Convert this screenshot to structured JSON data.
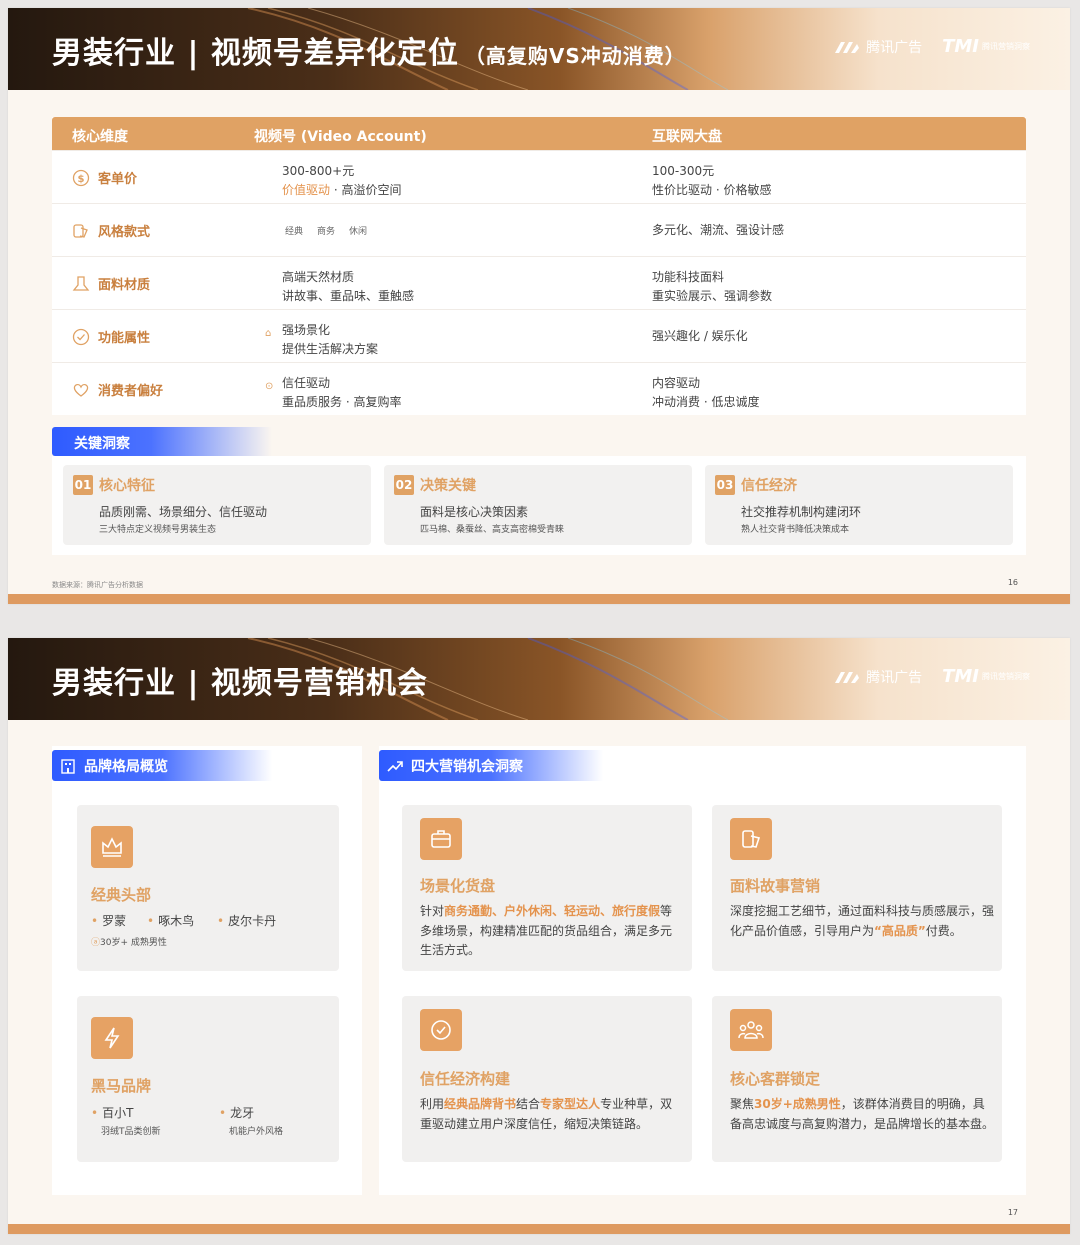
{
  "slide1": {
    "title": "男装行业 | 视频号差异化定位",
    "title_sub": "（高复购VS冲动消费）",
    "logo_tencent": "腾讯广告",
    "logo_tmi_mark": "TMI",
    "logo_tmi_text": "腾讯营销洞察",
    "table": {
      "headers": [
        "核心维度",
        "视频号 (Video Account)",
        "互联网大盘"
      ],
      "rows": [
        {
          "dim": "客单价",
          "icon": "dollar-icon",
          "va_line1": "300-800+元",
          "va_line2_hl": "价值驱动",
          "va_sep": "·",
          "va_line2_rest": "高溢价空间",
          "net_line1": "100-300元",
          "net_line2": "性价比驱动 · 价格敏感"
        },
        {
          "dim": "风格款式",
          "icon": "style-icon",
          "va_tags": [
            "经典",
            "商务",
            "休闲"
          ],
          "net_line1": "多元化、潮流、强设计感"
        },
        {
          "dim": "面料材质",
          "icon": "fabric-icon",
          "va_line1": "高端天然材质",
          "va_line2": "讲故事、重品味、重触感",
          "net_line1": "功能科技面料",
          "net_line2": "重实验展示、强调参数"
        },
        {
          "dim": "功能属性",
          "icon": "check-circle-icon",
          "va_line1": "强场景化",
          "va_line2": "提供生活解决方案",
          "net_line1": "强兴趣化 / 娱乐化"
        },
        {
          "dim": "消费者偏好",
          "icon": "heart-icon",
          "va_line1": "信任驱动",
          "va_line2": "重品质服务 · 高复购率",
          "net_line1": "内容驱动",
          "net_line2": "冲动消费 · 低忠诚度"
        }
      ]
    },
    "insight_title": "关键洞察",
    "insights": [
      {
        "num": "01",
        "title": "核心特征",
        "line1": "品质刚需、场景细分、信任驱动",
        "line2": "三大特点定义视频号男装生态"
      },
      {
        "num": "02",
        "title": "决策关键",
        "line1": "面料是核心决策因素",
        "line2": "匹马棉、桑蚕丝、高支高密棉受青睐"
      },
      {
        "num": "03",
        "title": "信任经济",
        "line1": "社交推荐机制构建闭环",
        "line2": "熟人社交背书降低决策成本"
      }
    ],
    "source": "数据来源：腾讯广告分析数据",
    "page": "16"
  },
  "slide2": {
    "title": "男装行业 | 视频号营销机会",
    "logo_tencent": "腾讯广告",
    "logo_tmi_mark": "TMI",
    "logo_tmi_text": "腾讯营销洞察",
    "left_section": "品牌格局概览",
    "classic": {
      "title": "经典头部",
      "brands": [
        "罗蒙",
        "啄木鸟",
        "皮尔卡丹"
      ],
      "note": "30岁+ 成熟男性"
    },
    "darkhorse": {
      "title": "黑马品牌",
      "brands": [
        {
          "name": "百小T",
          "desc": "羽绒T品类创新"
        },
        {
          "name": "龙牙",
          "desc": "机能户外风格"
        }
      ]
    },
    "right_section": "四大营销机会洞察",
    "opportunities": [
      {
        "title": "场景化货盘",
        "icon": "briefcase-icon",
        "t1": "针对",
        "h1": "商务通勤、户外休闲、轻运动、旅行度假",
        "t2": "等多维场景，构建精准匹配的货品组合，满足多元生活方式。"
      },
      {
        "title": "面料故事营销",
        "icon": "fabric-story-icon",
        "t1": "深度挖掘工艺细节，通过面料科技与质感展示，强化产品价值感，引导用户为",
        "h1": "“高品质”",
        "t2": "付费。"
      },
      {
        "title": "信任经济构建",
        "icon": "check-circle-icon",
        "t1": "利用",
        "h1": "经典品牌背书",
        "t2": "结合",
        "h2": "专家型达人",
        "t3": "专业种草，双重驱动建立用户深度信任，缩短决策链路。"
      },
      {
        "title": "核心客群锁定",
        "icon": "group-icon",
        "t1": "聚焦",
        "h1": "30岁+成熟男性",
        "t2": "，该群体消费目的明确，具备高忠诚度与高复购潜力，是品牌增长的基本盘。"
      }
    ],
    "page": "17"
  }
}
